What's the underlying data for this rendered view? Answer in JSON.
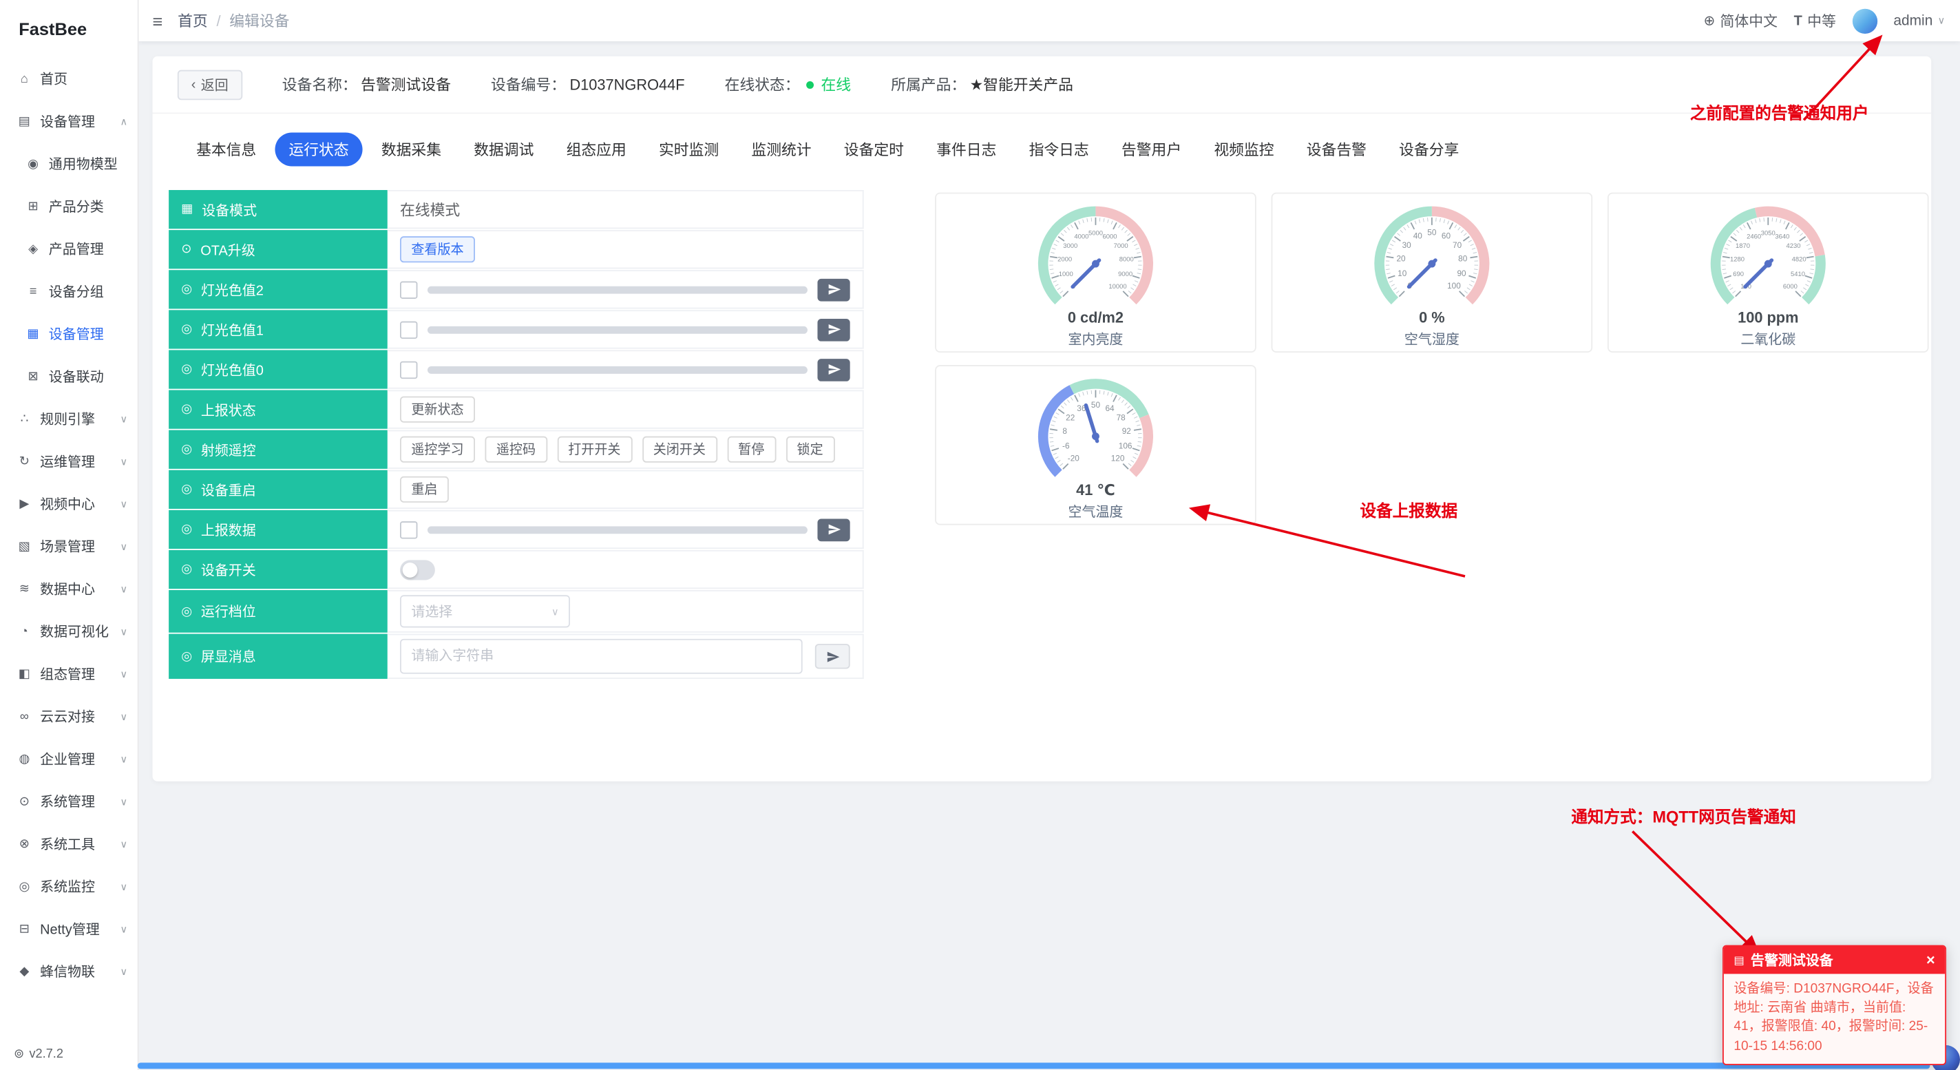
{
  "app": {
    "name": "FastBee",
    "version": "v2.7.2"
  },
  "colors": {
    "accent": "#2d6bf0",
    "success": "#13ce66",
    "danger": "#f5222d",
    "label_teal": "#1fc2a2",
    "annotation_red": "#e60012"
  },
  "icons": {
    "hamburger": "≡",
    "globe": "⊕",
    "font_size": "T",
    "chevron_down": "∨",
    "chevron_up": "∧",
    "user_chevron": "∨",
    "back_arrow": "‹",
    "version": "⊚",
    "alert": "▤",
    "close": "×"
  },
  "topbar": {
    "breadcrumb_home": "首页",
    "breadcrumb_sep": "/",
    "breadcrumb_current": "编辑设备",
    "language": "简体中文",
    "font_size": "中等",
    "username": "admin"
  },
  "sidebar": {
    "items": [
      {
        "label": "首页",
        "icon": "home-icon",
        "glyph": "⌂"
      },
      {
        "label": "设备管理",
        "icon": "device-manage-icon",
        "glyph": "▤",
        "chevron": true,
        "expanded": true,
        "children": [
          {
            "label": "通用物模型",
            "icon": "thing-model-icon",
            "glyph": "◉"
          },
          {
            "label": "产品分类",
            "icon": "product-category-icon",
            "glyph": "⊞"
          },
          {
            "label": "产品管理",
            "icon": "product-manage-icon",
            "glyph": "◈"
          },
          {
            "label": "设备分组",
            "icon": "device-group-icon",
            "glyph": "≡"
          },
          {
            "label": "设备管理",
            "icon": "device-list-icon",
            "glyph": "▦",
            "active": true
          },
          {
            "label": "设备联动",
            "icon": "device-link-icon",
            "glyph": "⊠"
          }
        ]
      },
      {
        "label": "规则引擎",
        "icon": "rule-engine-icon",
        "glyph": "∴",
        "chevron": true
      },
      {
        "label": "运维管理",
        "icon": "ops-manage-icon",
        "glyph": "↻",
        "chevron": true
      },
      {
        "label": "视频中心",
        "icon": "video-center-icon",
        "glyph": "▶",
        "chevron": true
      },
      {
        "label": "场景管理",
        "icon": "scene-manage-icon",
        "glyph": "▧",
        "chevron": true
      },
      {
        "label": "数据中心",
        "icon": "data-center-icon",
        "glyph": "≋",
        "chevron": true
      },
      {
        "label": "数据可视化",
        "icon": "data-visual-icon",
        "glyph": "◔",
        "chevron": true
      },
      {
        "label": "组态管理",
        "icon": "scada-manage-icon",
        "glyph": "◧",
        "chevron": true
      },
      {
        "label": "云云对接",
        "icon": "cloud-connect-icon",
        "glyph": "∞",
        "chevron": true
      },
      {
        "label": "企业管理",
        "icon": "enterprise-icon",
        "glyph": "◍",
        "chevron": true
      },
      {
        "label": "系统管理",
        "icon": "system-manage-icon",
        "glyph": "⊙",
        "chevron": true
      },
      {
        "label": "系统工具",
        "icon": "system-tools-icon",
        "glyph": "⊗",
        "chevron": true
      },
      {
        "label": "系统监控",
        "icon": "system-monitor-icon",
        "glyph": "◎",
        "chevron": true
      },
      {
        "label": "Netty管理",
        "icon": "netty-manage-icon",
        "glyph": "⊟",
        "chevron": true
      },
      {
        "label": "蜂信物联",
        "icon": "fastbee-iot-icon",
        "glyph": "◆",
        "chevron": true
      }
    ]
  },
  "device_header": {
    "back": "返回",
    "name_label": "设备名称：",
    "name": "告警测试设备",
    "sn_label": "设备编号：",
    "sn": "D1037NGRO44F",
    "status_label": "在线状态：",
    "status": "在线",
    "product_label": "所属产品：",
    "product": "★智能开关产品"
  },
  "tabs": [
    {
      "label": "基本信息"
    },
    {
      "label": "运行状态",
      "active": true
    },
    {
      "label": "数据采集"
    },
    {
      "label": "数据调试"
    },
    {
      "label": "组态应用"
    },
    {
      "label": "实时监测"
    },
    {
      "label": "监测统计"
    },
    {
      "label": "设备定时"
    },
    {
      "label": "事件日志"
    },
    {
      "label": "指令日志"
    },
    {
      "label": "告警用户"
    },
    {
      "label": "视频监控"
    },
    {
      "label": "设备告警"
    },
    {
      "label": "设备分享"
    }
  ],
  "status_rows": [
    {
      "label": "设备模式",
      "icon": "grid-icon",
      "glyph": "▦",
      "type": "text",
      "value": "在线模式"
    },
    {
      "label": "OTA升级",
      "icon": "ota-icon",
      "glyph": "⊙",
      "type": "buttons",
      "variant": "primary",
      "buttons": [
        "查看版本"
      ]
    },
    {
      "label": "灯光色值2",
      "icon": "eye-icon",
      "glyph": "◎",
      "type": "slider"
    },
    {
      "label": "灯光色值1",
      "icon": "eye-icon",
      "glyph": "◎",
      "type": "slider"
    },
    {
      "label": "灯光色值0",
      "icon": "eye-icon",
      "glyph": "◎",
      "type": "slider"
    },
    {
      "label": "上报状态",
      "icon": "eye-icon",
      "glyph": "◎",
      "type": "buttons",
      "buttons": [
        "更新状态"
      ]
    },
    {
      "label": "射频遥控",
      "icon": "eye-icon",
      "glyph": "◎",
      "type": "buttons",
      "buttons": [
        "遥控学习",
        "遥控码",
        "打开开关",
        "关闭开关",
        "暂停",
        "锁定"
      ]
    },
    {
      "label": "设备重启",
      "icon": "eye-icon",
      "glyph": "◎",
      "type": "buttons",
      "buttons": [
        "重启"
      ]
    },
    {
      "label": "上报数据",
      "icon": "eye-icon",
      "glyph": "◎",
      "type": "slider"
    },
    {
      "label": "设备开关",
      "icon": "eye-icon",
      "glyph": "◎",
      "type": "switch"
    },
    {
      "label": "运行档位",
      "icon": "eye-icon",
      "glyph": "◎",
      "type": "select",
      "placeholder": "请选择"
    },
    {
      "label": "屏显消息",
      "icon": "eye-icon",
      "glyph": "◎",
      "type": "input",
      "placeholder": "请输入字符串"
    }
  ],
  "chart_data": [
    {
      "type": "gauge",
      "title": "室内亮度",
      "value": 0,
      "unit": "cd/m2",
      "display": "0 cd/m2",
      "min": 0,
      "max": 10000,
      "splits": 10,
      "segments": [
        [
          0.5,
          "#a9e3cf"
        ],
        [
          1,
          "#f3c2c5"
        ]
      ]
    },
    {
      "type": "gauge",
      "title": "空气湿度",
      "value": 0,
      "unit": "%",
      "display": "0 %",
      "min": 0,
      "max": 100,
      "splits": 10,
      "segments": [
        [
          0.5,
          "#a9e3cf"
        ],
        [
          1,
          "#f3c2c5"
        ]
      ]
    },
    {
      "type": "gauge",
      "title": "二氧化碳",
      "value": 100,
      "unit": "ppm",
      "display": "100 ppm",
      "min": 100,
      "max": 6000,
      "splits": 10,
      "segments": [
        [
          0.45,
          "#a9e3cf"
        ],
        [
          0.8,
          "#f3c2c5"
        ],
        [
          1,
          "#a9e3cf"
        ]
      ]
    },
    {
      "type": "gauge",
      "title": "空气温度",
      "value": 41,
      "unit": "℃",
      "display": "41 ℃",
      "min": -20,
      "max": 120,
      "splits": 10,
      "segments": [
        [
          0.4,
          "#7d9bf0"
        ],
        [
          0.75,
          "#a9e3cf"
        ],
        [
          1,
          "#f3c2c5"
        ]
      ]
    }
  ],
  "annotations": {
    "top": "之前配置的告警通知用户",
    "middle": "设备上报数据",
    "bottom": "通知方式：MQTT网页告警通知"
  },
  "toast": {
    "title": "告警测试设备",
    "body": "设备编号: D1037NGRO44F，设备地址: 云南省 曲靖市，当前值: 41，报警限值: 40，报警时间: 25-10-15 14:56:00"
  }
}
